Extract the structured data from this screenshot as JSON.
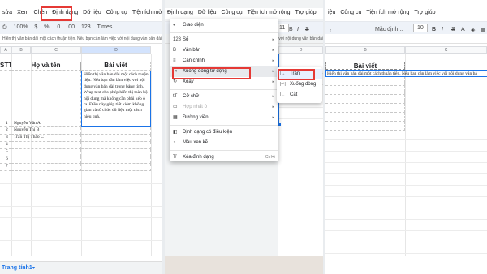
{
  "panel1": {
    "menu": [
      "sửa",
      "Xem",
      "Chèn",
      "Định dạng",
      "Dữ liệu",
      "Công cụ",
      "Tiện ích mở rộng"
    ],
    "toolbar": {
      "print": "⎙",
      "zoom": "100%",
      "currency": "$",
      "percent": "%",
      "decimal": ".0",
      "decimal2": ".00",
      "number": "123",
      "font": "Times..."
    },
    "formula": "Hiển thị văn bản dài một cách thuận tiện. Nếu bạn cần làm việc với nội dung văn bản dài",
    "cols": [
      "A",
      "B",
      "C",
      "D"
    ],
    "headers": {
      "stt": "STT",
      "name": "Họ và tên",
      "post": "Bài viết"
    },
    "rows": [
      {
        "num": "1",
        "name": "Nguyễn Văn A"
      },
      {
        "num": "2",
        "name": "Nguyễn Thị B"
      },
      {
        "num": "3",
        "name": "Trần Thị Thảo C"
      },
      {
        "num": "4",
        "name": ""
      },
      {
        "num": "5",
        "name": ""
      },
      {
        "num": "6",
        "name": ""
      },
      {
        "num": "7",
        "name": ""
      }
    ],
    "wrapped_text": "Hiển thị văn bản dài một cách thuận tiện. Nếu bạn cần làm việc với nội dung văn bản dài trong bảng tính, Wrap text cho phép hiển thị toàn bộ nội dung mà không cần phải kéo ô ra. Điều này giúp tiết kiệm không gian và tổ chức dữ liệu một cách hiệu quả.",
    "sheet_tab": "Trang tính1"
  },
  "panel2": {
    "menu": [
      "Định dạng",
      "Dữ liệu",
      "Công cụ",
      "Tiện ích mở rộng",
      "Trợ giúp"
    ],
    "font_size": "11",
    "formula": "việc với nội dung văn bản dài trong bảng tính, Wo",
    "col": "D",
    "format_menu": [
      {
        "icon": "◐",
        "label": "Giao diện",
        "arrow": false
      },
      {
        "sep": true
      },
      {
        "icon": "123",
        "label": "Số",
        "arrow": true
      },
      {
        "icon": "B",
        "label": "Văn bản",
        "arrow": true
      },
      {
        "icon": "≡",
        "label": "Căn chỉnh",
        "arrow": true
      },
      {
        "icon": "⇥",
        "label": "Xuống dòng tự động",
        "arrow": true,
        "active": true
      },
      {
        "icon": "↻",
        "label": "Xoay",
        "arrow": true
      },
      {
        "sep": true
      },
      {
        "icon": "tT",
        "label": "Cỡ chữ",
        "arrow": true
      },
      {
        "icon": "▭",
        "label": "Hợp nhất ô",
        "arrow": true,
        "disabled": true
      },
      {
        "icon": "▦",
        "label": "Đường viền",
        "arrow": true
      },
      {
        "sep": true
      },
      {
        "icon": "◧",
        "label": "Định dạng có điều kiện",
        "arrow": false
      },
      {
        "icon": "◑",
        "label": "Màu xen kẽ",
        "arrow": false
      },
      {
        "sep": true
      },
      {
        "icon": "T̸",
        "label": "Xóa định dạng",
        "shortcut": "Ctrl+\\",
        "arrow": false
      }
    ],
    "wrap_submenu": [
      {
        "icon": "|→",
        "label": "Tràn",
        "active": true
      },
      {
        "icon": "|↵|",
        "label": "Xuống dòng"
      },
      {
        "icon": "|←",
        "label": "Cắt"
      }
    ]
  },
  "panel3": {
    "menu": [
      "iệu",
      "Công cụ",
      "Tiện ích mở rộng",
      "Trợ giúp"
    ],
    "font": "Mặc định...",
    "font_size": "10",
    "col_left": "B",
    "col_right": "C",
    "header": "Bài viết",
    "overflow_text": "Hiển thị văn bản dài một cách thuận tiện. Nếu bạn cần làm việc với nội dung văn bả"
  },
  "colors": {
    "highlight": "#e53935",
    "selection": "#1a73e8",
    "toolbar_bg": "#eef2f8"
  }
}
